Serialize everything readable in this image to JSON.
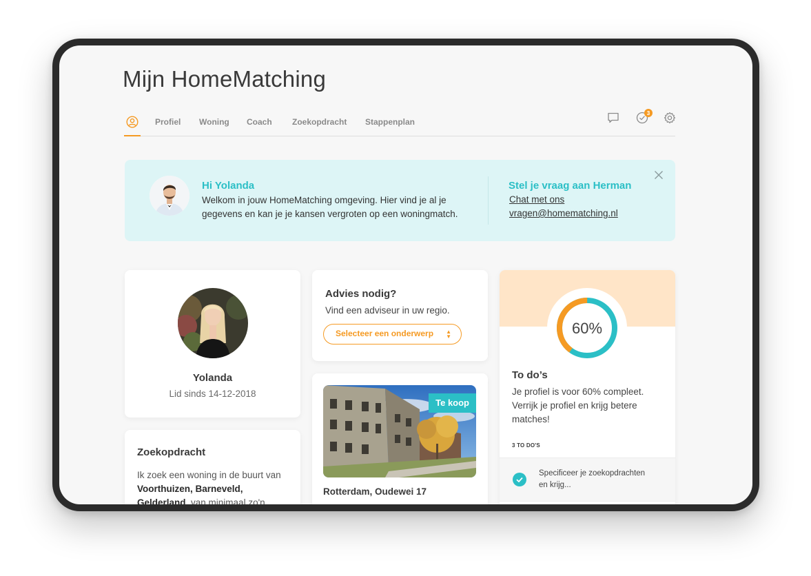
{
  "page": {
    "title": "Mijn HomeMatching"
  },
  "nav": {
    "items": [
      {
        "label": "Profiel"
      },
      {
        "label": "Woning"
      },
      {
        "label": "Coach"
      },
      {
        "label": "Zoekopdracht"
      },
      {
        "label": "Stappenplan"
      }
    ],
    "notifications_count": "3"
  },
  "banner": {
    "greeting": "Hi Yolanda",
    "message": "Welkom in jouw HomeMatching omgeving. Hier vind je al je gegevens en kan je je kansen vergroten op een woningmatch.",
    "ask_title": "Stel je vraag aan Herman",
    "chat_link": "Chat met ons",
    "email_link": "vragen@homematching.nl"
  },
  "profile": {
    "name": "Yolanda",
    "member_since": "Lid sinds 14-12-2018"
  },
  "search": {
    "title": "Zoekopdracht",
    "text_before": "Ik zoek een woning in de buurt van ",
    "text_bold": "Voorthuizen, Barneveld, Gelderland",
    "text_after": ", van minimaal zo'n"
  },
  "advice": {
    "title": "Advies nodig?",
    "text": "Vind een adviseur in uw regio.",
    "select_placeholder": "Selecteer een onderwerp"
  },
  "house": {
    "tag": "Te koop",
    "address": "Rotterdam, Oudewei 17"
  },
  "todo": {
    "percent": 60,
    "percent_label": "60%",
    "title": "To do’s",
    "text": "Je profiel is voor 60% compleet. Verrijk je profiel en krijg betere matches!",
    "count_label": "3 TO DO'S",
    "items": [
      {
        "label": "Specificeer je zoekopdrachten en krijg..."
      }
    ]
  },
  "colors": {
    "accent_orange": "#f59a23",
    "accent_teal": "#2bbfc6",
    "banner_bg": "#ddf5f6",
    "todo_header_bg": "#ffe5c8"
  },
  "icons": [
    "user-icon",
    "chat-icon",
    "check-badge-icon",
    "gear-icon",
    "close-icon",
    "check-icon"
  ]
}
